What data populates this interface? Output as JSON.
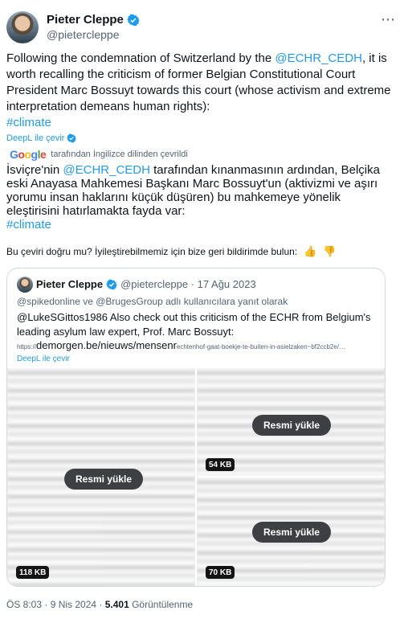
{
  "author": {
    "name": "Pieter Cleppe",
    "handle": "@pietercleppe",
    "more_icon": "⋯"
  },
  "tweet": {
    "text_pre": "Following the condemnation of Switzerland by the ",
    "mention": "@ECHR_CEDH",
    "text_post": ", it is worth recalling the criticism of former Belgian Constitutional Court President Marc Bossuyt towards this court (whose activism and extreme interpretation demeans human rights):",
    "hashtag": "#climate"
  },
  "deepl_label": "DeepL ile çevir",
  "google": {
    "logo_parts": [
      "G",
      "o",
      "o",
      "g",
      "l",
      "e"
    ],
    "attribution": "tarafından İngilizce dilinden çevrildi"
  },
  "translation": {
    "text_pre": "İsviçre'nin ",
    "mention": "@ECHR_CEDH",
    "text_post": " tarafından kınanmasının ardından, Belçika eski Anayasa Mahkemesi Başkanı Marc Bossuyt'un (aktivizmi ve aşırı yorumu insan haklarını küçük düşüren) bu mahkemeye yönelik eleştirisini hatırlamakta fayda var:",
    "hashtag": "#climate"
  },
  "feedback": {
    "question": "Bu çeviri doğru mu? İyileştirebilmemiz için bize geri bildirimde bulun:",
    "up_icon": "👍",
    "down_icon": "👎"
  },
  "quote": {
    "name": "Pieter Cleppe",
    "meta": "@pietercleppe · 17 Ağu 2023",
    "reply_to": "@spikedonline ve @BrugesGroup adlı kullanıcılara yanıt olarak",
    "text": "@LukeSGittos1986 Also check out this criticism of the ECHR from Belgium's leading asylum law expert, Prof. Marc Bossuyt:",
    "url_scheme": "https://",
    "url_main": "demorgen.be/nieuws/mensenr",
    "url_tail": "echtenhof-gaat-boekje-te-buiten-in-asielzaken~bf2ccb2e/…",
    "deepl_label": "DeepL ile çevir",
    "media": [
      {
        "button": "Resmi yükle",
        "size": "118 KB"
      },
      {
        "button": "Resmi yükle",
        "size": "54 KB"
      },
      {
        "button": "Resmi yükle",
        "size": "70 KB"
      }
    ]
  },
  "footer": {
    "time_date": "ÖS 8:03 · 9 Nis 2024 · ",
    "views_count": "5.401",
    "views_label": " Görüntülenme"
  },
  "colors": {
    "link": "#1d9bf0",
    "secondary_text": "#536471",
    "border": "#cfd9de"
  }
}
